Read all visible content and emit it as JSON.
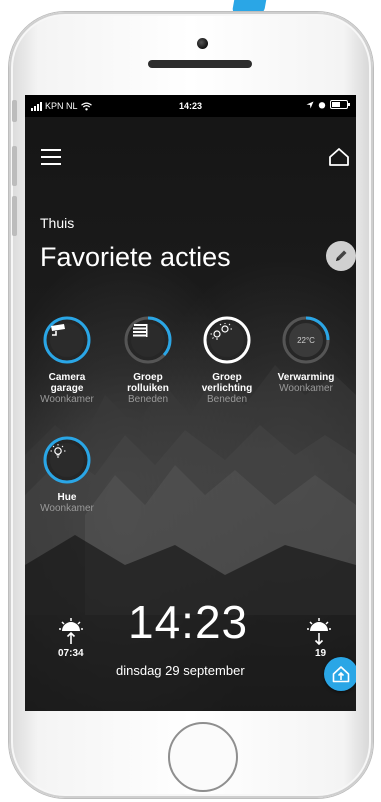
{
  "status_bar": {
    "carrier": "KPN NL",
    "time": "14:23"
  },
  "header": {
    "subtitle": "Thuis",
    "title": "Favoriete acties"
  },
  "icons": {
    "menu": "hamburger-menu-icon",
    "home": "house-outline-icon",
    "edit": "pencil-icon",
    "camera": "security-camera-icon",
    "shutters": "roller-shutter-icon",
    "lights": "light-bulbs-icon",
    "hue": "light-bulb-icon",
    "sunrise": "sunrise-icon",
    "sunset": "sunset-icon",
    "upload": "home-arrow-icon"
  },
  "actions": [
    {
      "name_line1": "Camera",
      "name_line2": "garage",
      "room": "Woonkamer"
    },
    {
      "name_line1": "Groep",
      "name_line2": "rolluiken",
      "room": "Beneden"
    },
    {
      "name_line1": "Groep",
      "name_line2": "verlichting",
      "room": "Beneden"
    },
    {
      "name_line1": "Verwarming",
      "name_line2": "",
      "room": "Woonkamer",
      "value": "22°C"
    },
    {
      "name_line1": "Hue",
      "name_line2": "",
      "room": "Woonkamer"
    }
  ],
  "footer": {
    "sunrise_time": "07:34",
    "sunset_time_partial": "19",
    "clock": "14:23",
    "date": "dinsdag 29 september"
  },
  "colors": {
    "accent": "#2aa6e6",
    "screen_bg": "#1d1d1d"
  }
}
